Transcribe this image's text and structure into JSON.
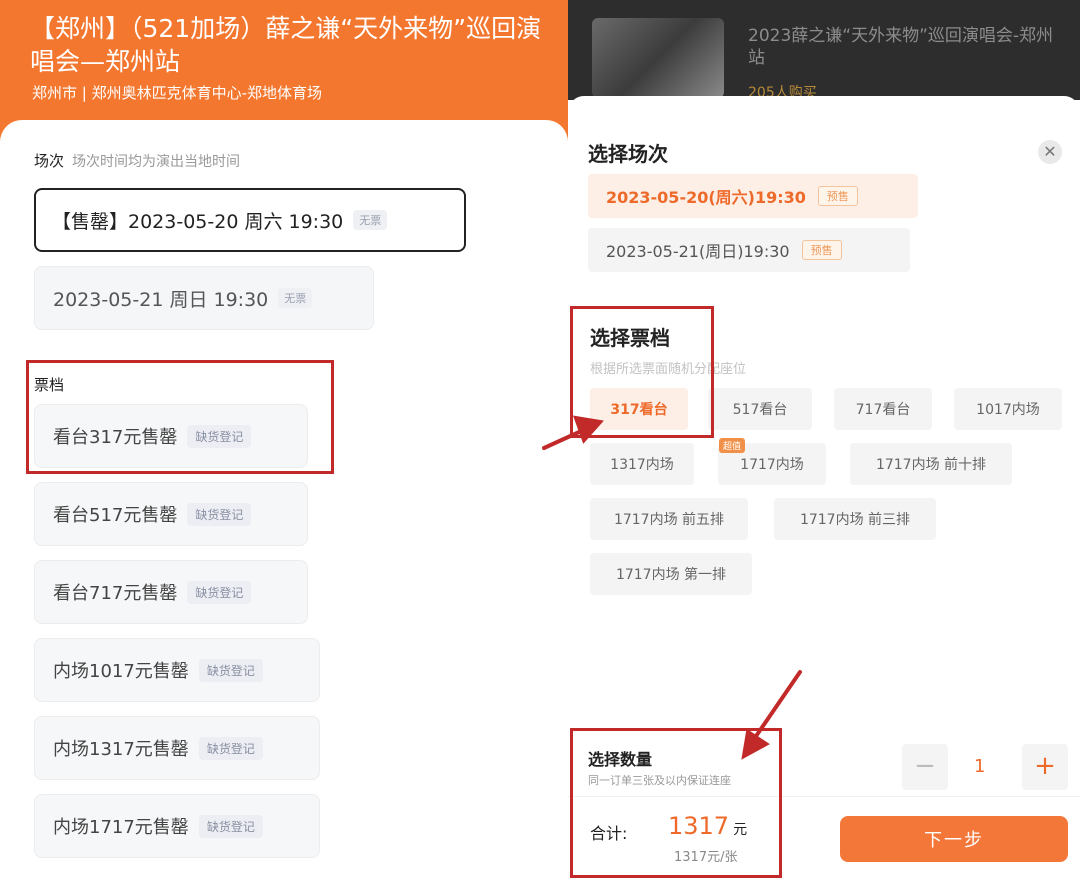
{
  "left": {
    "header": {
      "title": "【郑州】（521加场）薛之谦“天外来物”巡回演唱会—郑州站",
      "venue": "郑州市 | 郑州奥林匹克体育中心-郑地体育场"
    },
    "session_section": {
      "label": "场次",
      "hint": "场次时间均为演出当地时间"
    },
    "sessions": [
      {
        "text": "【售罄】2023-05-20 周六 19:30",
        "badge": "无票"
      },
      {
        "text": "2023-05-21 周日 19:30",
        "badge": "无票"
      }
    ],
    "tier_section": {
      "label": "票档"
    },
    "tiers": [
      {
        "text": "看台317元售罄",
        "action": "缺货登记"
      },
      {
        "text": "看台517元售罄",
        "action": "缺货登记"
      },
      {
        "text": "看台717元售罄",
        "action": "缺货登记"
      },
      {
        "text": "内场1017元售罄",
        "action": "缺货登记"
      },
      {
        "text": "内场1317元售罄",
        "action": "缺货登记"
      },
      {
        "text": "内场1717元售罄",
        "action": "缺货登记"
      }
    ]
  },
  "right": {
    "event": {
      "title": "2023薛之谦“天外来物”巡回演唱会-郑州站",
      "buyers": "205人购买"
    },
    "session_section": {
      "label": "选择场次"
    },
    "sessions": [
      {
        "text": "2023-05-20(周六)19:30",
        "badge": "预售",
        "selected": true
      },
      {
        "text": "2023-05-21(周日)19:30",
        "badge": "预售",
        "selected": false
      }
    ],
    "tier_section": {
      "label": "选择票档",
      "hint": "根据所选票面随机分配座位"
    },
    "tiers": [
      {
        "text": "317看台",
        "selected": true
      },
      {
        "text": "517看台"
      },
      {
        "text": "717看台"
      },
      {
        "text": "1017内场"
      },
      {
        "text": "1317内场"
      },
      {
        "text": "1717内场",
        "tag": "超值"
      },
      {
        "text": "1717内场 前十排"
      },
      {
        "text": "1717内场 前五排"
      },
      {
        "text": "1717内场 前三排"
      },
      {
        "text": "1717内场 第一排"
      }
    ],
    "quantity": {
      "label": "选择数量",
      "note": "同一订单三张及以内保证连座",
      "minus": "−",
      "plus": "+",
      "value": "1"
    },
    "total": {
      "label": "合计:",
      "amount": "1317",
      "unit": "元",
      "unit_price": "1317元/张"
    },
    "next_button": "下一步",
    "close_icon": "close-icon"
  },
  "colors": {
    "brand_orange": "#f4772f",
    "highlight_red": "#c22a2a",
    "accent_text": "#ee6a2a"
  }
}
